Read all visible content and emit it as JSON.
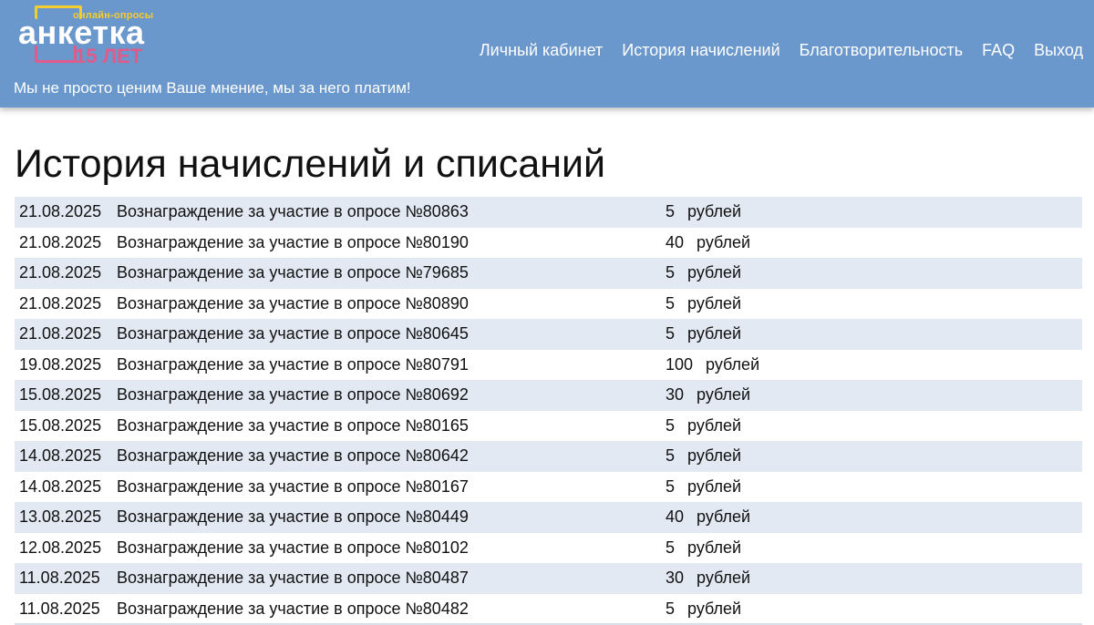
{
  "header": {
    "logo": {
      "tagline": "онлайн-опросы",
      "word": "анкетка",
      "years": "15 ЛЕТ"
    },
    "nav": [
      {
        "label": "Личный кабинет"
      },
      {
        "label": "История начислений"
      },
      {
        "label": "Благотворительность"
      },
      {
        "label": "FAQ"
      },
      {
        "label": "Выход"
      }
    ],
    "slogan": "Мы не просто ценим Ваше мнение, мы за него платим!"
  },
  "main": {
    "title": "История начислений и списаний",
    "transactions": [
      {
        "date": "21.08.2025",
        "description": "Вознаграждение за участие в опросе №80863",
        "amount": "5",
        "unit": "рублей"
      },
      {
        "date": "21.08.2025",
        "description": "Вознаграждение за участие в опросе №80190",
        "amount": "40",
        "unit": "рублей"
      },
      {
        "date": "21.08.2025",
        "description": "Вознаграждение за участие в опросе №79685",
        "amount": "5",
        "unit": "рублей"
      },
      {
        "date": "21.08.2025",
        "description": "Вознаграждение за участие в опросе №80890",
        "amount": "5",
        "unit": "рублей"
      },
      {
        "date": "21.08.2025",
        "description": "Вознаграждение за участие в опросе №80645",
        "amount": "5",
        "unit": "рублей"
      },
      {
        "date": "19.08.2025",
        "description": "Вознаграждение за участие в опросе №80791",
        "amount": "100",
        "unit": "рублей"
      },
      {
        "date": "15.08.2025",
        "description": "Вознаграждение за участие в опросе №80692",
        "amount": "30",
        "unit": "рублей"
      },
      {
        "date": "15.08.2025",
        "description": "Вознаграждение за участие в опросе №80165",
        "amount": "5",
        "unit": "рублей"
      },
      {
        "date": "14.08.2025",
        "description": "Вознаграждение за участие в опросе №80642",
        "amount": "5",
        "unit": "рублей"
      },
      {
        "date": "14.08.2025",
        "description": "Вознаграждение за участие в опросе №80167",
        "amount": "5",
        "unit": "рублей"
      },
      {
        "date": "13.08.2025",
        "description": "Вознаграждение за участие в опросе №80449",
        "amount": "40",
        "unit": "рублей"
      },
      {
        "date": "12.08.2025",
        "description": "Вознаграждение за участие в опросе №80102",
        "amount": "5",
        "unit": "рублей"
      },
      {
        "date": "11.08.2025",
        "description": "Вознаграждение за участие в опросе №80487",
        "amount": "30",
        "unit": "рублей"
      },
      {
        "date": "11.08.2025",
        "description": "Вознаграждение за участие в опросе №80482",
        "amount": "5",
        "unit": "рублей"
      }
    ]
  },
  "colors": {
    "header_bg": "#6a97cc",
    "row_alt_bg": "#e2e9f3",
    "logo_yellow": "#f5cd2e",
    "logo_pink": "#e15b8a"
  }
}
